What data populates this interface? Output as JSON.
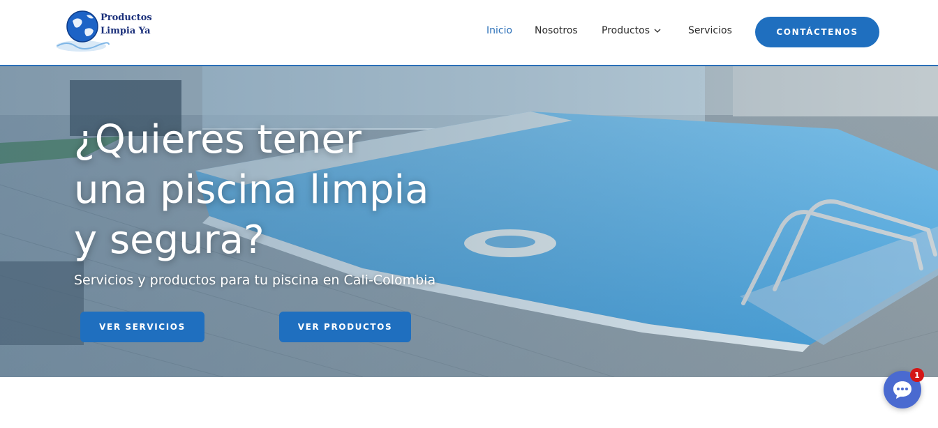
{
  "header": {
    "logo_line1": "Productos",
    "logo_line2": "Limpia Ya",
    "nav": [
      {
        "label": "Inicio"
      },
      {
        "label": "Nosotros"
      },
      {
        "label": "Productos"
      },
      {
        "label": "Servicios"
      }
    ],
    "cta_label": "CONTÁCTENOS"
  },
  "hero": {
    "title_line1": "¿Quieres tener",
    "title_line2": "una piscina limpia",
    "title_line3": "y segura?",
    "subtitle": "Servicios y productos para tu piscina en Cali-Colombia",
    "btn_services": "VER SERVICIOS",
    "btn_products": "VER PRODUCTOS"
  },
  "chat": {
    "badge_count": "1",
    "icon": "chat-bubble-icon"
  },
  "colors": {
    "brand_blue": "#1f6fbf",
    "active_nav": "#2a6fb8",
    "badge_red": "#d41515",
    "chat_bg": "#4a6ad0"
  }
}
